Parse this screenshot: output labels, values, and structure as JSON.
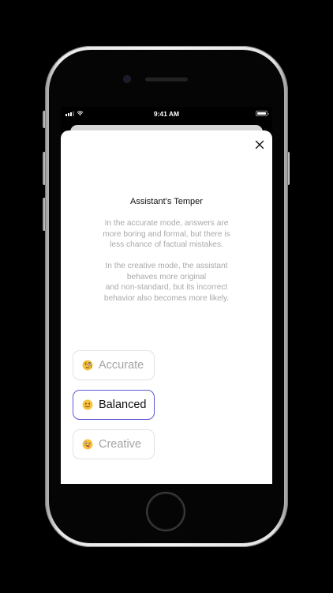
{
  "status_bar": {
    "time": "9:41 AM"
  },
  "sheet": {
    "title": "Assistant’s Temper",
    "description_accurate": "In the accurate mode, answers are\nmore boring and formal, but there is\nless chance of factual mistakes.",
    "description_creative": "In the creative mode, the assistant\nbehaves more original\nand non-standard, but its incorrect\nbehavior also becomes more likely."
  },
  "options": [
    {
      "label": "Accurate",
      "icon": "face-with-monocle-icon",
      "selected": false
    },
    {
      "label": "Balanced",
      "icon": "slightly-smiling-face-icon",
      "selected": true
    },
    {
      "label": "Creative",
      "icon": "zany-face-icon",
      "selected": false
    }
  ],
  "colors": {
    "accent": "#5b5bd6",
    "emoji_yellow": "#f7c23c",
    "muted_text": "#a9a9a9"
  }
}
